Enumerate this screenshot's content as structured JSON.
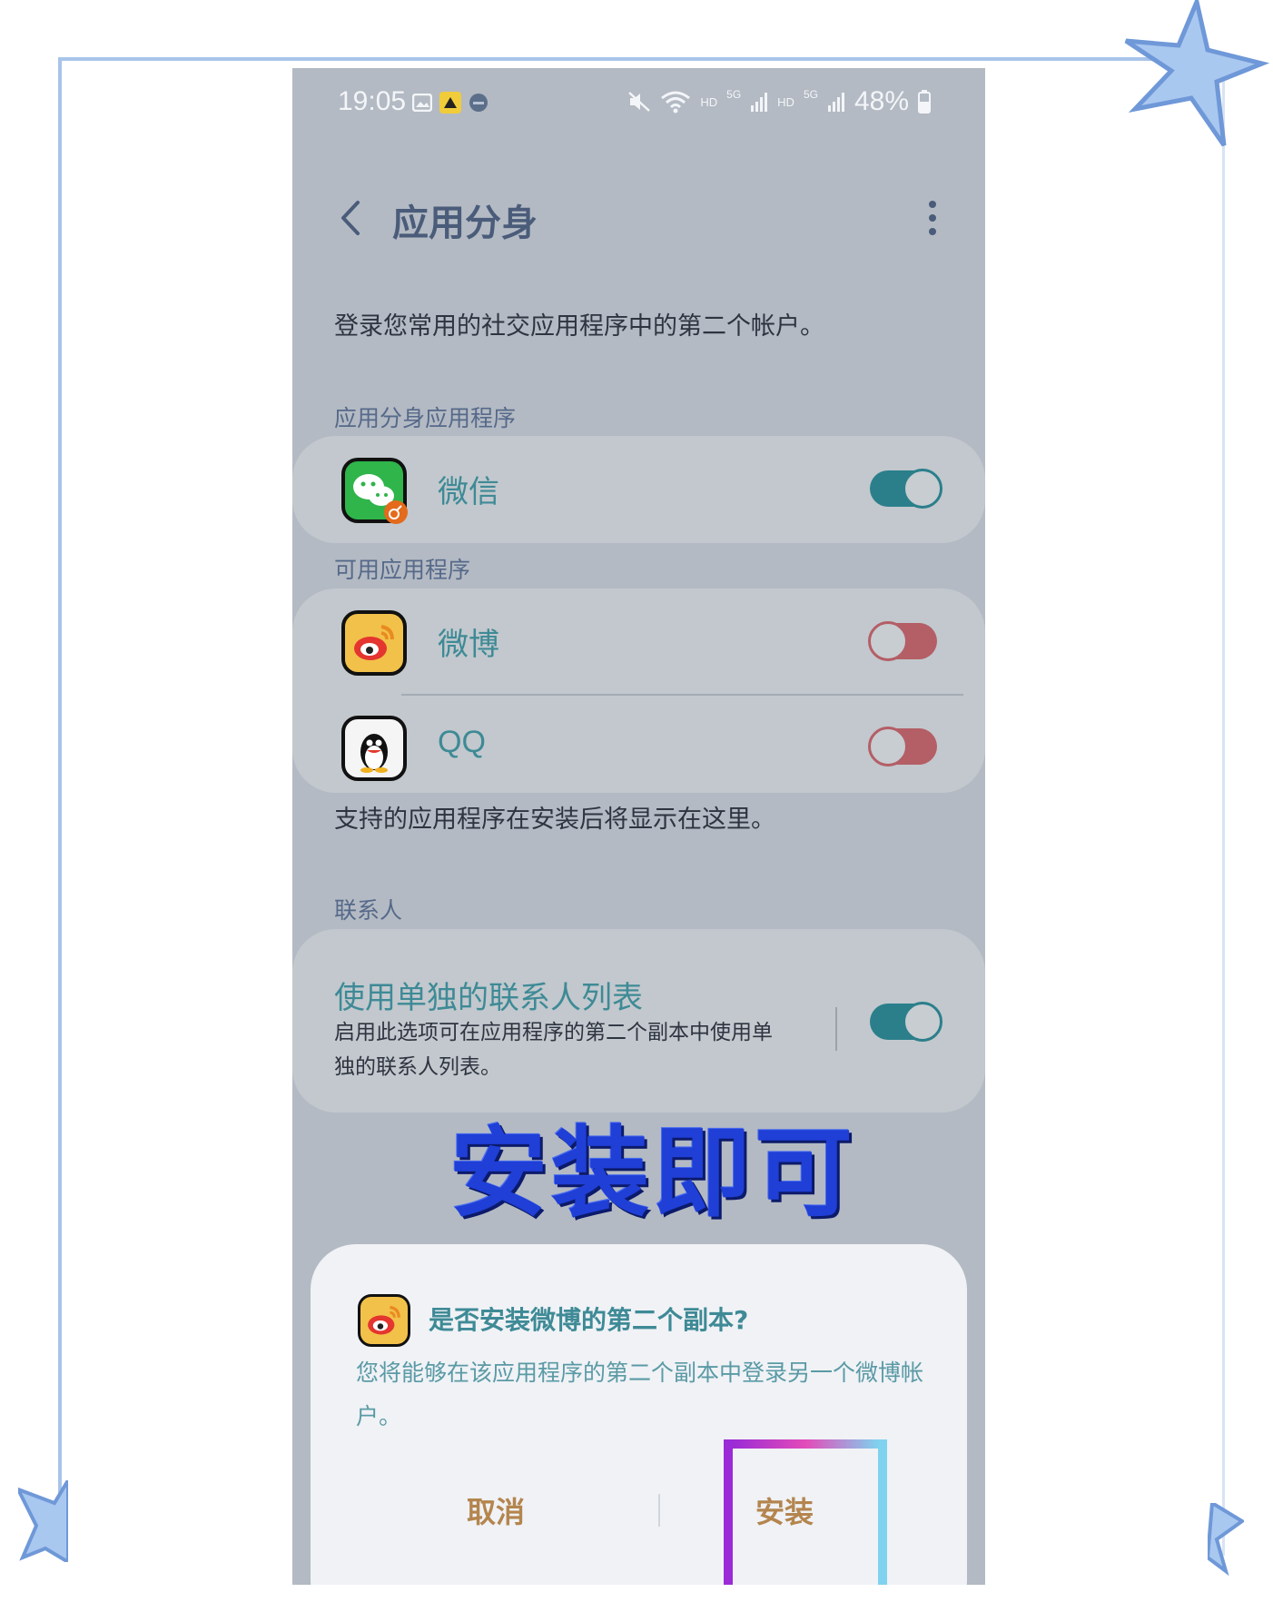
{
  "status_bar": {
    "time": "19:05",
    "battery": "48%",
    "hd1": "HD",
    "hd2": "HD",
    "net1": "5G",
    "net2": "5G",
    "icons": [
      "gallery-icon",
      "notification-app-icon",
      "app-dot-icon",
      "mute-icon",
      "wifi-icon",
      "signal-icon",
      "signal-icon",
      "battery-icon"
    ]
  },
  "app_bar": {
    "title": "应用分身"
  },
  "intro": "登录您常用的社交应用程序中的第二个帐户。",
  "section_clone": {
    "label": "应用分身应用程序",
    "items": [
      {
        "name": "微信",
        "icon": "wechat-icon",
        "enabled": true
      }
    ]
  },
  "section_available": {
    "label": "可用应用程序",
    "items": [
      {
        "name": "微博",
        "icon": "weibo-icon",
        "enabled": false
      },
      {
        "name": "QQ",
        "icon": "qq-icon",
        "enabled": false
      }
    ]
  },
  "note": "支持的应用程序在安装后将显示在这里。",
  "section_contacts": {
    "label": "联系人",
    "title": "使用单独的联系人列表",
    "subtitle": "启用此选项可在应用程序的第二个副本中使用单独的联系人列表。",
    "enabled": true
  },
  "overlay_caption": "安装即可",
  "dialog": {
    "title": "是否安装微博的第二个副本?",
    "body": "您将能够在该应用程序的第二个副本中登录另一个微博帐户。",
    "cancel_label": "取消",
    "install_label": "安装"
  },
  "colors": {
    "accent_teal": "#2b7f8b",
    "toggle_off": "#b45e66",
    "overlay_blue": "#1f3fd6",
    "dialog_button": "#b4854e"
  }
}
